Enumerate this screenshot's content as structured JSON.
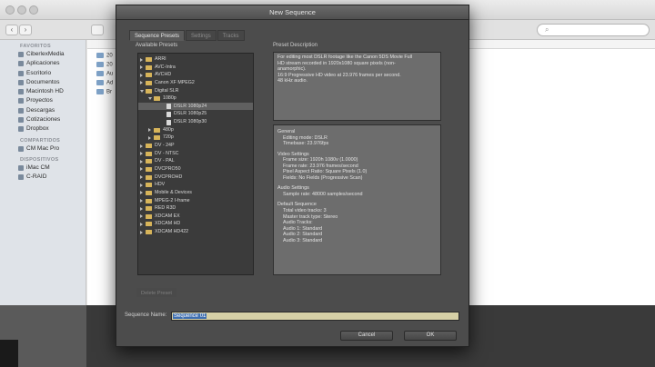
{
  "finder": {
    "toolbar_search_placeholder": "",
    "sidebar": {
      "sections": [
        {
          "heading": "FAVORITOS",
          "items": [
            "CiberlexMedia",
            "Aplicaciones",
            "Escritorio",
            "Documentos",
            "Macintosh HD",
            "Proyectos",
            "Descargas",
            "Cotizaciones",
            "Dropbox"
          ]
        },
        {
          "heading": "COMPARTIDOS",
          "items": [
            "CM Mac Pro"
          ]
        },
        {
          "heading": "DISPOSITIVOS",
          "items": [
            "iMac CM",
            "C-RAID"
          ]
        }
      ]
    },
    "list_rows": [
      "20",
      "20",
      "Au",
      "Ad",
      "Br"
    ]
  },
  "dialog": {
    "title": "New Sequence",
    "tabs": [
      {
        "label": "Sequence Presets",
        "active": true
      },
      {
        "label": "Settings",
        "active": false
      },
      {
        "label": "Tracks",
        "active": false
      }
    ],
    "available_presets_label": "Available Presets",
    "preset_description_label": "Preset Description",
    "tree": [
      {
        "label": "ARRI",
        "level": 0,
        "kind": "folder",
        "expanded": false
      },
      {
        "label": "AVC-Intra",
        "level": 0,
        "kind": "folder",
        "expanded": false
      },
      {
        "label": "AVCHD",
        "level": 0,
        "kind": "folder",
        "expanded": false
      },
      {
        "label": "Canon XF MPEG2",
        "level": 0,
        "kind": "folder",
        "expanded": false
      },
      {
        "label": "Digital SLR",
        "level": 0,
        "kind": "folder",
        "expanded": true
      },
      {
        "label": "1080p",
        "level": 1,
        "kind": "folder",
        "expanded": true
      },
      {
        "label": "DSLR 1080p24",
        "level": 2,
        "kind": "file",
        "selected": true
      },
      {
        "label": "DSLR 1080p25",
        "level": 2,
        "kind": "file"
      },
      {
        "label": "DSLR 1080p30",
        "level": 2,
        "kind": "file"
      },
      {
        "label": "480p",
        "level": 1,
        "kind": "folder",
        "expanded": false
      },
      {
        "label": "720p",
        "level": 1,
        "kind": "folder",
        "expanded": false
      },
      {
        "label": "DV - 24P",
        "level": 0,
        "kind": "folder",
        "expanded": false
      },
      {
        "label": "DV - NTSC",
        "level": 0,
        "kind": "folder",
        "expanded": false
      },
      {
        "label": "DV - PAL",
        "level": 0,
        "kind": "folder",
        "expanded": false
      },
      {
        "label": "DVCPRO50",
        "level": 0,
        "kind": "folder",
        "expanded": false
      },
      {
        "label": "DVCPROHD",
        "level": 0,
        "kind": "folder",
        "expanded": false
      },
      {
        "label": "HDV",
        "level": 0,
        "kind": "folder",
        "expanded": false
      },
      {
        "label": "Mobile & Devices",
        "level": 0,
        "kind": "folder",
        "expanded": false
      },
      {
        "label": "MPEG-2 I-frame",
        "level": 0,
        "kind": "folder",
        "expanded": false
      },
      {
        "label": "RED R3D",
        "level": 0,
        "kind": "folder",
        "expanded": false
      },
      {
        "label": "XDCAM EX",
        "level": 0,
        "kind": "folder",
        "expanded": false
      },
      {
        "label": "XDCAM HD",
        "level": 0,
        "kind": "folder",
        "expanded": false
      },
      {
        "label": "XDCAM HD422",
        "level": 0,
        "kind": "folder",
        "expanded": false
      }
    ],
    "description_lines": [
      "For editing most DSLR footage like the Canon 5DS Movie Full",
      "HD stream recorded in 1920x1080 square pixels (non-",
      "anamorphic).",
      "16:9 Progressive HD video at 23.976 frames per second.",
      "48 kHz audio."
    ],
    "general_lines": [
      {
        "text": "General",
        "indent": false,
        "gap": false
      },
      {
        "text": "Editing mode: DSLR",
        "indent": true,
        "gap": false
      },
      {
        "text": "Timebase: 23.976fps",
        "indent": true,
        "gap": false
      },
      {
        "text": "Video Settings",
        "indent": false,
        "gap": true
      },
      {
        "text": "Frame size: 1920h 1080v (1.0000)",
        "indent": true,
        "gap": false
      },
      {
        "text": "Frame rate: 23.976 frames/second",
        "indent": true,
        "gap": false
      },
      {
        "text": "Pixel Aspect Ratio: Square Pixels (1.0)",
        "indent": true,
        "gap": false
      },
      {
        "text": "Fields: No Fields (Progressive Scan)",
        "indent": true,
        "gap": false
      },
      {
        "text": "Audio Settings",
        "indent": false,
        "gap": true
      },
      {
        "text": "Sample rate: 48000 samples/second",
        "indent": true,
        "gap": false
      },
      {
        "text": "Default Sequence",
        "indent": false,
        "gap": true
      },
      {
        "text": "Total video tracks: 3",
        "indent": true,
        "gap": false
      },
      {
        "text": "Master track type: Stereo",
        "indent": true,
        "gap": false
      },
      {
        "text": "Audio Tracks:",
        "indent": true,
        "gap": false
      },
      {
        "text": "Audio 1: Standard",
        "indent": true,
        "gap": false
      },
      {
        "text": "Audio 2: Standard",
        "indent": true,
        "gap": false
      },
      {
        "text": "Audio 3: Standard",
        "indent": true,
        "gap": false
      }
    ],
    "delete_preset_label": "Delete Preset",
    "sequence_name_label": "Sequence Name:",
    "sequence_name_value": "Sequence 01",
    "cancel_label": "Cancel",
    "ok_label": "OK"
  }
}
